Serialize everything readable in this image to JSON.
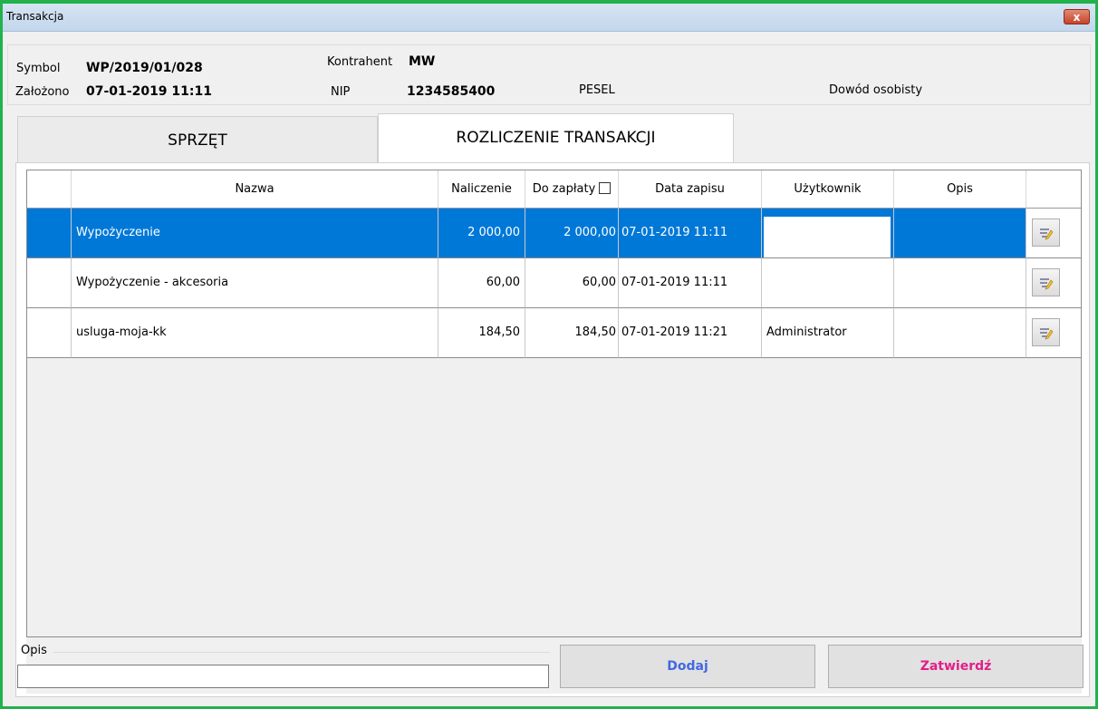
{
  "window": {
    "title": "Transakcja",
    "close_label": "x"
  },
  "header": {
    "symbol_label": "Symbol",
    "symbol_value": "WP/2019/01/028",
    "zalozono_label": "Założono",
    "zalozono_value": "07-01-2019 11:11",
    "kontrahent_label": "Kontrahent",
    "kontrahent_value": "MW",
    "nip_label": "NIP",
    "nip_value": "1234585400",
    "pesel_label": "PESEL",
    "dowod_label": "Dowód osobisty"
  },
  "tabs": [
    {
      "label": "SPRZĘT",
      "active": false
    },
    {
      "label": "ROZLICZENIE TRANSAKCJI",
      "active": true
    }
  ],
  "grid": {
    "columns": [
      "",
      "Nazwa",
      "Naliczenie",
      "Do zapłaty",
      "Data zapisu",
      "Użytkownik",
      "Opis",
      ""
    ],
    "rows": [
      {
        "nazwa": "Wypożyczenie",
        "naliczenie": "2 000,00",
        "do_zaplaty": "2 000,00",
        "data": "07-01-2019 11:11",
        "uzytkownik": "",
        "opis": "",
        "selected": true
      },
      {
        "nazwa": "Wypożyczenie - akcesoria",
        "naliczenie": "60,00",
        "do_zaplaty": "60,00",
        "data": "07-01-2019 11:11",
        "uzytkownik": "",
        "opis": "",
        "selected": false
      },
      {
        "nazwa": "usluga-moja-kk",
        "naliczenie": "184,50",
        "do_zaplaty": "184,50",
        "data": "07-01-2019 11:21",
        "uzytkownik": "Administrator",
        "opis": "",
        "selected": false
      }
    ]
  },
  "footer": {
    "opis_label": "Opis",
    "opis_value": "",
    "dodaj_label": "Dodaj",
    "zatwierdz_label": "Zatwierdź"
  },
  "colors": {
    "selection": "#0078d7",
    "window_border": "#22b14c",
    "dodaj_text": "#4169e1",
    "zatwierdz_text": "#e0208a"
  }
}
